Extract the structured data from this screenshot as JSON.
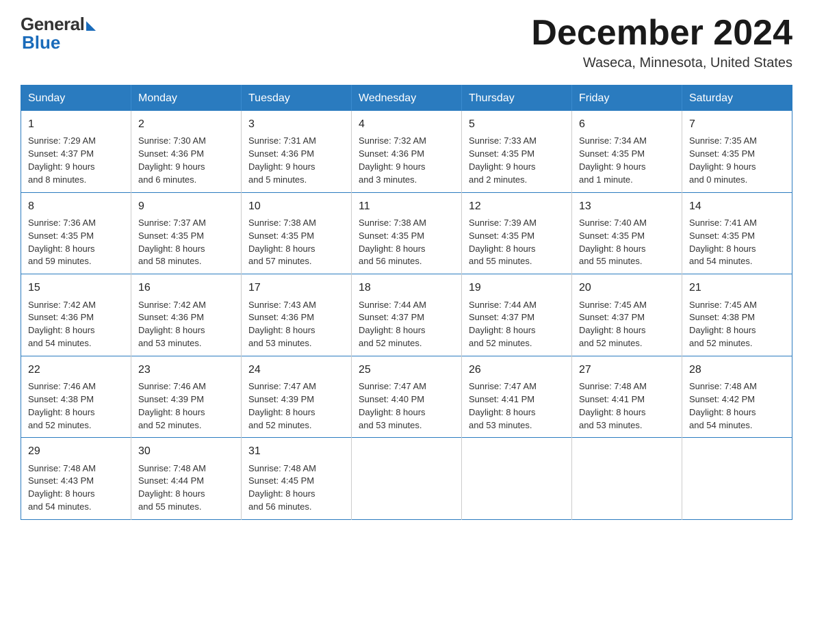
{
  "logo": {
    "general": "General",
    "blue": "Blue"
  },
  "title": "December 2024",
  "location": "Waseca, Minnesota, United States",
  "days_of_week": [
    "Sunday",
    "Monday",
    "Tuesday",
    "Wednesday",
    "Thursday",
    "Friday",
    "Saturday"
  ],
  "weeks": [
    [
      {
        "day": "1",
        "sunrise": "7:29 AM",
        "sunset": "4:37 PM",
        "daylight": "9 hours and 8 minutes."
      },
      {
        "day": "2",
        "sunrise": "7:30 AM",
        "sunset": "4:36 PM",
        "daylight": "9 hours and 6 minutes."
      },
      {
        "day": "3",
        "sunrise": "7:31 AM",
        "sunset": "4:36 PM",
        "daylight": "9 hours and 5 minutes."
      },
      {
        "day": "4",
        "sunrise": "7:32 AM",
        "sunset": "4:36 PM",
        "daylight": "9 hours and 3 minutes."
      },
      {
        "day": "5",
        "sunrise": "7:33 AM",
        "sunset": "4:35 PM",
        "daylight": "9 hours and 2 minutes."
      },
      {
        "day": "6",
        "sunrise": "7:34 AM",
        "sunset": "4:35 PM",
        "daylight": "9 hours and 1 minute."
      },
      {
        "day": "7",
        "sunrise": "7:35 AM",
        "sunset": "4:35 PM",
        "daylight": "9 hours and 0 minutes."
      }
    ],
    [
      {
        "day": "8",
        "sunrise": "7:36 AM",
        "sunset": "4:35 PM",
        "daylight": "8 hours and 59 minutes."
      },
      {
        "day": "9",
        "sunrise": "7:37 AM",
        "sunset": "4:35 PM",
        "daylight": "8 hours and 58 minutes."
      },
      {
        "day": "10",
        "sunrise": "7:38 AM",
        "sunset": "4:35 PM",
        "daylight": "8 hours and 57 minutes."
      },
      {
        "day": "11",
        "sunrise": "7:38 AM",
        "sunset": "4:35 PM",
        "daylight": "8 hours and 56 minutes."
      },
      {
        "day": "12",
        "sunrise": "7:39 AM",
        "sunset": "4:35 PM",
        "daylight": "8 hours and 55 minutes."
      },
      {
        "day": "13",
        "sunrise": "7:40 AM",
        "sunset": "4:35 PM",
        "daylight": "8 hours and 55 minutes."
      },
      {
        "day": "14",
        "sunrise": "7:41 AM",
        "sunset": "4:35 PM",
        "daylight": "8 hours and 54 minutes."
      }
    ],
    [
      {
        "day": "15",
        "sunrise": "7:42 AM",
        "sunset": "4:36 PM",
        "daylight": "8 hours and 54 minutes."
      },
      {
        "day": "16",
        "sunrise": "7:42 AM",
        "sunset": "4:36 PM",
        "daylight": "8 hours and 53 minutes."
      },
      {
        "day": "17",
        "sunrise": "7:43 AM",
        "sunset": "4:36 PM",
        "daylight": "8 hours and 53 minutes."
      },
      {
        "day": "18",
        "sunrise": "7:44 AM",
        "sunset": "4:37 PM",
        "daylight": "8 hours and 52 minutes."
      },
      {
        "day": "19",
        "sunrise": "7:44 AM",
        "sunset": "4:37 PM",
        "daylight": "8 hours and 52 minutes."
      },
      {
        "day": "20",
        "sunrise": "7:45 AM",
        "sunset": "4:37 PM",
        "daylight": "8 hours and 52 minutes."
      },
      {
        "day": "21",
        "sunrise": "7:45 AM",
        "sunset": "4:38 PM",
        "daylight": "8 hours and 52 minutes."
      }
    ],
    [
      {
        "day": "22",
        "sunrise": "7:46 AM",
        "sunset": "4:38 PM",
        "daylight": "8 hours and 52 minutes."
      },
      {
        "day": "23",
        "sunrise": "7:46 AM",
        "sunset": "4:39 PM",
        "daylight": "8 hours and 52 minutes."
      },
      {
        "day": "24",
        "sunrise": "7:47 AM",
        "sunset": "4:39 PM",
        "daylight": "8 hours and 52 minutes."
      },
      {
        "day": "25",
        "sunrise": "7:47 AM",
        "sunset": "4:40 PM",
        "daylight": "8 hours and 53 minutes."
      },
      {
        "day": "26",
        "sunrise": "7:47 AM",
        "sunset": "4:41 PM",
        "daylight": "8 hours and 53 minutes."
      },
      {
        "day": "27",
        "sunrise": "7:48 AM",
        "sunset": "4:41 PM",
        "daylight": "8 hours and 53 minutes."
      },
      {
        "day": "28",
        "sunrise": "7:48 AM",
        "sunset": "4:42 PM",
        "daylight": "8 hours and 54 minutes."
      }
    ],
    [
      {
        "day": "29",
        "sunrise": "7:48 AM",
        "sunset": "4:43 PM",
        "daylight": "8 hours and 54 minutes."
      },
      {
        "day": "30",
        "sunrise": "7:48 AM",
        "sunset": "4:44 PM",
        "daylight": "8 hours and 55 minutes."
      },
      {
        "day": "31",
        "sunrise": "7:48 AM",
        "sunset": "4:45 PM",
        "daylight": "8 hours and 56 minutes."
      },
      null,
      null,
      null,
      null
    ]
  ],
  "labels": {
    "sunrise": "Sunrise:",
    "sunset": "Sunset:",
    "daylight": "Daylight:"
  }
}
